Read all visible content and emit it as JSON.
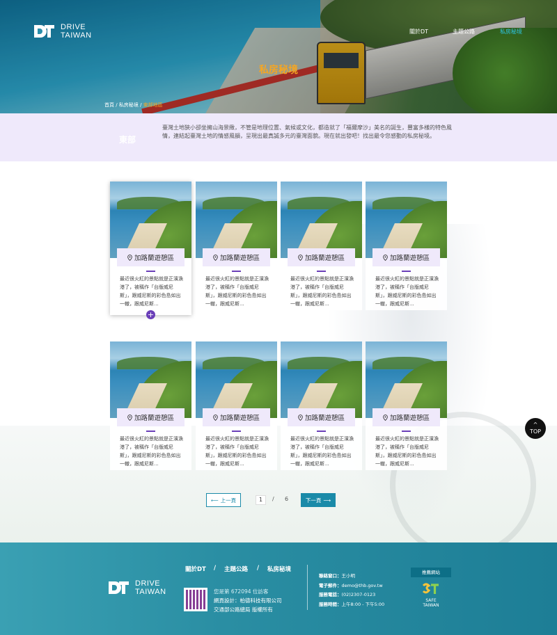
{
  "brand": {
    "mark": "DT",
    "line1": "DRIVE",
    "line2": "TAIWAN"
  },
  "nav": [
    {
      "label": "關於DT"
    },
    {
      "label": "主題公路"
    },
    {
      "label": "私房秘境",
      "active": true
    }
  ],
  "hero": {
    "title": "私房秘境"
  },
  "breadcrumb": {
    "home": "首頁",
    "sep": "/",
    "section": "私房秘境",
    "current": "東部地區"
  },
  "region": {
    "name": "東部",
    "description": "臺灣土地狹小卻坐擁山海景緻，不管是地理位置、氣候或文化，都造就了「福爾摩沙」美名的誕生，豐富多樣的特色風情，連結起臺灣土地的情感風韻，呈現出最真誠多元的臺灣面貌。現在就出發吧！找出最令您感動的私房秘境。"
  },
  "cards": [
    {
      "title": "加路蘭遊憩區",
      "text": "最近很火紅的景點就是正濱漁港了，被稱作「台版威尼斯」，跟威尼斯的彩色島如出一轍，跟威尼斯...",
      "active": true
    },
    {
      "title": "加路蘭遊憩區",
      "text": "最近很火紅的景點就是正濱漁港了，被稱作「台版威尼斯」，跟威尼斯的彩色島如出一轍，跟威尼斯..."
    },
    {
      "title": "加路蘭遊憩區",
      "text": "最近很火紅的景點就是正濱漁港了，被稱作「台版威尼斯」，跟威尼斯的彩色島如出一轍，跟威尼斯..."
    },
    {
      "title": "加路蘭遊憩區",
      "text": "最近很火紅的景點就是正濱漁港了，被稱作「台版威尼斯」，跟威尼斯的彩色島如出一轍，跟威尼斯..."
    },
    {
      "title": "加路蘭遊憩區",
      "text": "最近很火紅的景點就是正濱漁港了，被稱作「台版威尼斯」，跟威尼斯的彩色島如出一轍，跟威尼斯..."
    },
    {
      "title": "加路蘭遊憩區",
      "text": "最近很火紅的景點就是正濱漁港了，被稱作「台版威尼斯」，跟威尼斯的彩色島如出一轍，跟威尼斯..."
    },
    {
      "title": "加路蘭遊憩區",
      "text": "最近很火紅的景點就是正濱漁港了，被稱作「台版威尼斯」，跟威尼斯的彩色島如出一轍，跟威尼斯..."
    },
    {
      "title": "加路蘭遊憩區",
      "text": "最近很火紅的景點就是正濱漁港了，被稱作「台版威尼斯」，跟威尼斯的彩色島如出一轍，跟威尼斯..."
    }
  ],
  "card_more_symbol": "+",
  "pagination": {
    "prev": "上一頁",
    "next": "下一頁",
    "current": "1",
    "sep": "/",
    "total": "6"
  },
  "top_button": {
    "arrow": "^",
    "label": "TOP"
  },
  "footer": {
    "nav": [
      "關於DT",
      "/",
      "主題公路",
      "/",
      "私房秘境"
    ],
    "visits": "您是第 672094 位訪客",
    "design": "網頁設計：柏德科技有限公司",
    "copyright": "交通部公路總局 版權所有",
    "contact": [
      {
        "key": "聯絡窗口：",
        "value": "王小明"
      },
      {
        "key": "電子郵件：",
        "value": "demo@thb.gov.tw"
      },
      {
        "key": "服務電話：",
        "value": "(02)2307-0123"
      },
      {
        "key": "服務時間：",
        "value": "上午8:00 - 下午5:00"
      }
    ],
    "recommended": "推薦網站",
    "safe": {
      "mark": "ST",
      "line1": "SAFE",
      "line2": "TAIWAN"
    }
  },
  "colors": {
    "accent": "#1a8aa8",
    "purple": "#6a3fb8",
    "highlight": "#f5a623",
    "lavender": "#efe9fb"
  }
}
